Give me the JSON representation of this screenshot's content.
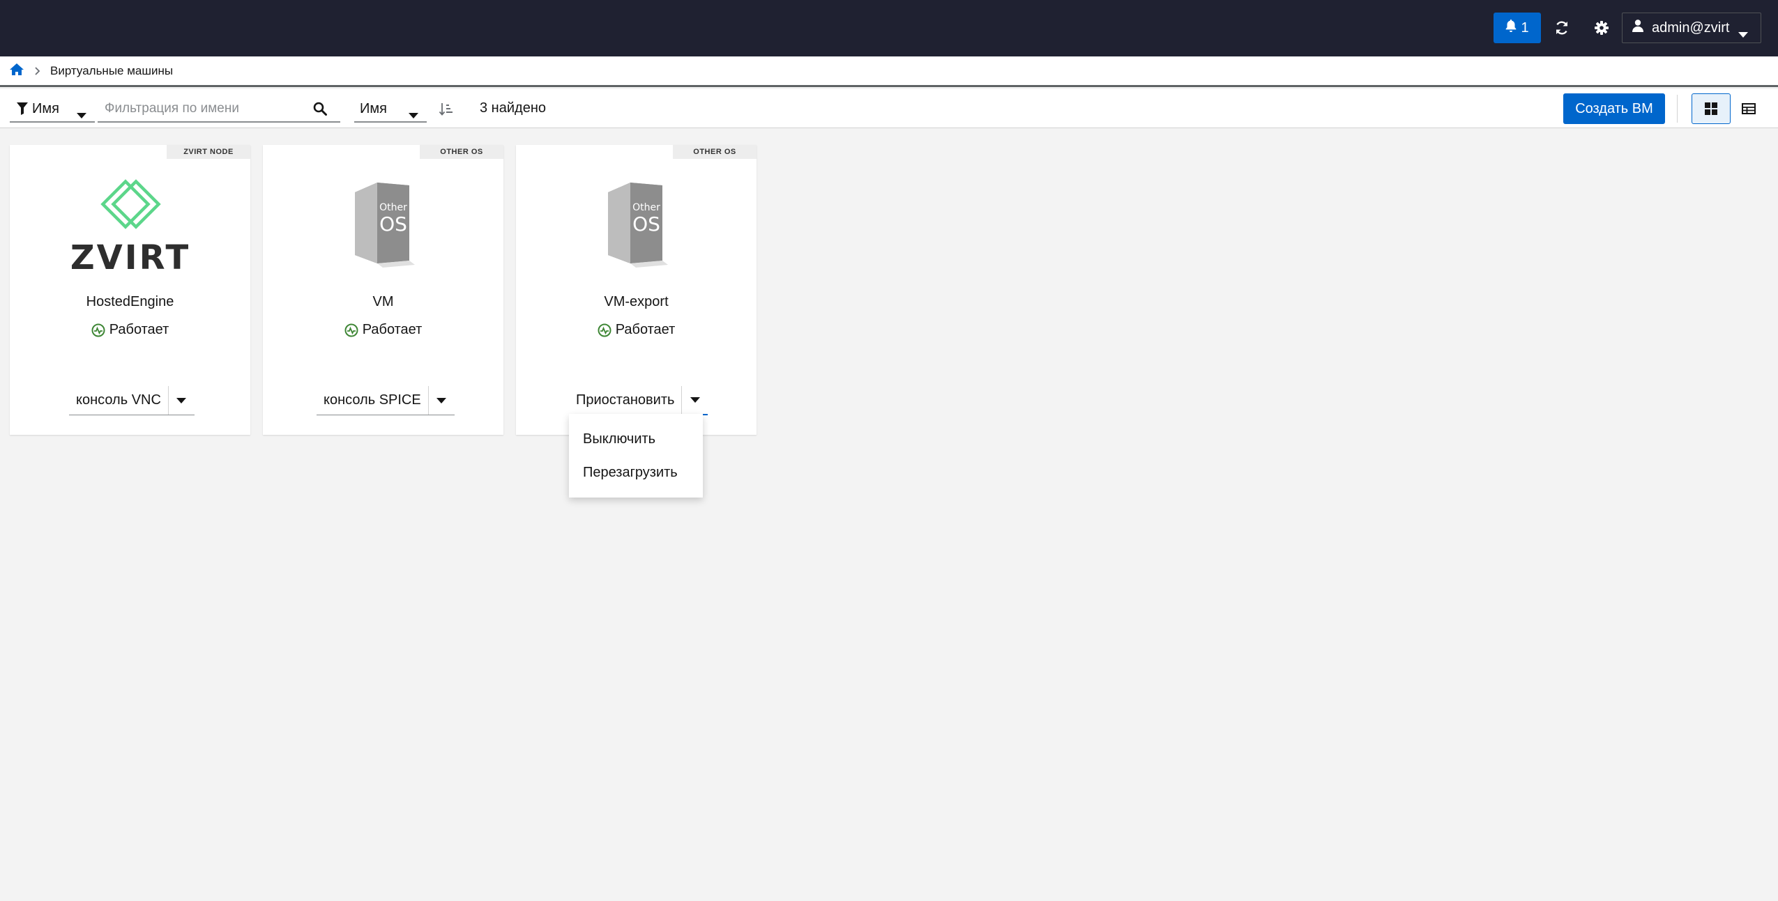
{
  "masthead": {
    "notifications_count": "1",
    "user": "admin@zvirt"
  },
  "breadcrumb": {
    "current": "Виртуальные машины"
  },
  "toolbar": {
    "filter_type": "Имя",
    "filter_placeholder": "Фильтрация по имени",
    "sort_field": "Имя",
    "found_text": "3 найдено",
    "create_label": "Создать ВМ",
    "active_view": "card"
  },
  "cards": [
    {
      "os_badge": "ZVIRT NODE",
      "logo": "zvirt-logo",
      "name": "HostedEngine",
      "status": "Работает",
      "action": "консоль VNC"
    },
    {
      "os_badge": "OTHER OS",
      "logo": "other-os-box",
      "logo_text_small": "Other",
      "logo_text_big": "OS",
      "name": "VM",
      "status": "Работает",
      "action": "консоль SPICE"
    },
    {
      "os_badge": "OTHER OS",
      "logo": "other-os-box",
      "logo_text_small": "Other",
      "logo_text_big": "OS",
      "name": "VM-export",
      "status": "Работает",
      "action": "Приостановить"
    }
  ],
  "logo_wordmark": "ZVIRT",
  "dropdown": {
    "items": [
      "Выключить",
      "Перезагрузить"
    ]
  },
  "colors": {
    "masthead": "#1f2131",
    "primary": "#0066cc",
    "status_ok": "#3e8635",
    "zvirt_green": "#5cd68a"
  }
}
